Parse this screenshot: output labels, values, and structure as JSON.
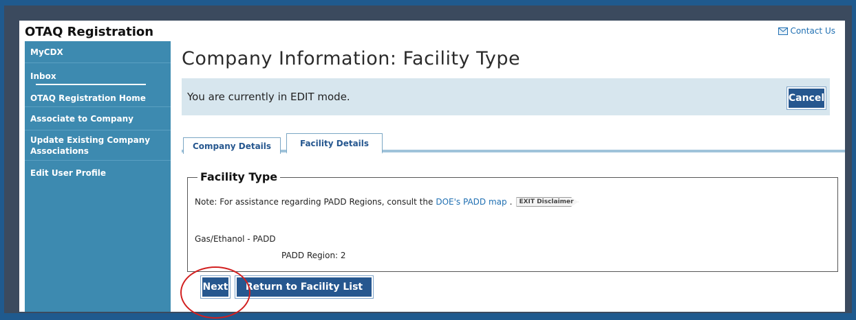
{
  "app": {
    "title": "OTAQ Registration",
    "contact_label": "Contact Us"
  },
  "sidebar": {
    "items": [
      {
        "label": "MyCDX"
      },
      {
        "label": "Inbox"
      },
      {
        "label": "OTAQ Registration Home"
      },
      {
        "label": "Associate to Company"
      },
      {
        "label": "Update Existing Company Associations"
      },
      {
        "label": "Edit User Profile"
      }
    ]
  },
  "main": {
    "page_title": "Company Information: Facility Type",
    "edit_mode_text": "You are currently in EDIT mode.",
    "cancel_label": "Cancel",
    "tabs": [
      {
        "label": "Company Details"
      },
      {
        "label": "Facility Details"
      }
    ],
    "facility": {
      "legend": "Facility Type",
      "note_prefix": "Note: For assistance regarding PADD Regions, consult the",
      "note_link": "DOE's PADD map",
      "note_suffix": ".",
      "exit_badge": "EXIT Disclaimer",
      "type_line": "Gas/Ethanol - PADD",
      "padd_region": "PADD Region:  2"
    },
    "next_label": "Next",
    "return_label": "Return to Facility List"
  },
  "colors": {
    "sidebar_bg": "#3d8ab0",
    "button_bg": "#26578f",
    "edit_bar_bg": "#d7e6ee",
    "highlight": "#d21f1f"
  }
}
